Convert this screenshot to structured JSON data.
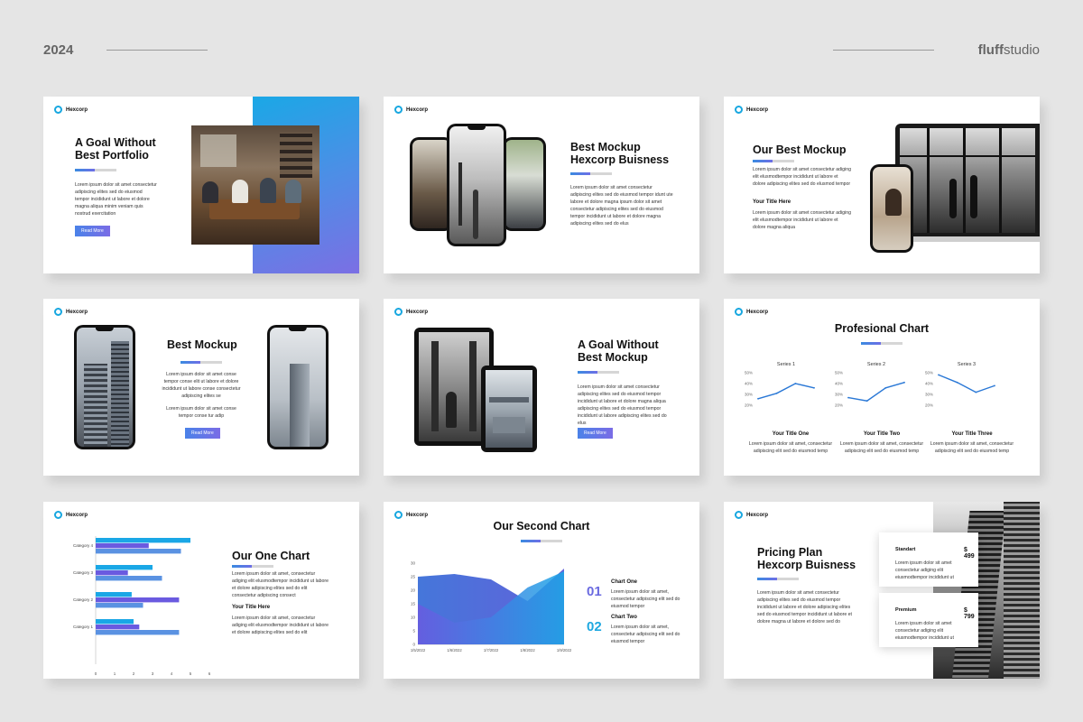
{
  "header": {
    "year": "2024",
    "brand_bold": "fluff",
    "brand_rest": "studio"
  },
  "logo_text": "Hexcorp",
  "lorem": "Lorem ipsum dolor sit amet consectetur adipiscing elites sed do eiusmod tempor incididunt ut labore et dolore",
  "slide1": {
    "title_l1": "A Goal Without",
    "title_l2": "Best Portfolio",
    "body": "Lorem ipsum dolor sit amet consectetur adipiscing elites sed do eiusmod tempor incididunt ut labore et dolore magna aliqua minim veniam quis nostrud exercitation",
    "button": "Read More"
  },
  "slide2": {
    "title_l1": "Best Mockup",
    "title_l2": "Hexcorp Buisness",
    "body": "Lorem ipsum dolor sit amet consectetur adipiscing elites sed do eiusmod tempor idunt ute labore et dolore magna ipsum dolor sit amet consectetur adipiscing elites sed do eiusmod tempor incididunt ut labore et dolore magna adipiscing elites sed do elus"
  },
  "slide3": {
    "title": "Our Best Mockup",
    "body1": "Lorem ipsum dolor sit amet consectetur adiging elit elusmodtempor incididunt ut labore et dolore adipiscing elites sed do elusmod tempor",
    "subtitle": "Your Title Here",
    "body2": "Lorem ipsum dolor sit amet consectetur adiging elit elusmodtempor incididunt ut labore et dolore magna aliqua"
  },
  "slide4": {
    "title": "Best Mockup",
    "body1": "Lorem ipsum dolor sit amet conse tempor conse elit ut labore et dolore incididunt ut labore conse consectetur adipiscing elites se",
    "body2": "Lorem ipsum dolor sit amet conse tempor conse tur adip",
    "button": "Read More"
  },
  "slide5": {
    "title_l1": "A Goal Without",
    "title_l2": "Best Mockup",
    "body": "Lorem ipsum dolor sit amet consectetur adipiscing elites sed do eiusmod tempor incididunt ut labore et dolore magna aliqua adipiscing elites sed do eiusmod tempor incididunt ut labore adipiscing elites sed do elus",
    "button": "Read More"
  },
  "slide6": {
    "title": "Profesional Chart",
    "items": [
      {
        "title": "Your Title One",
        "body": "Lorem ipsum dolor sit amet, consectetur adipiscing elit sed do eiusmod temp"
      },
      {
        "title": "Your Title Two",
        "body": "Lorem ipsum dolor sit amet, consectetur adipiscing elit sed do eiusmod temp"
      },
      {
        "title": "Your Title Three",
        "body": "Lorem ipsum dolor sit amet, consectetur adipiscing elit sed do eiusmod temp"
      }
    ]
  },
  "slide7": {
    "title": "Our One Chart",
    "body1": "Lorem ipsum dolor sit amet, consectetur adiging elit elusmodtempor incididunt ut labore et dolore adipiscing elites sed do elit consectetur adipiscing consect",
    "subtitle": "Your Title Here",
    "body2": "Lorem ipsum dolor sit amet, consectetur adiging elit elusmodtempor incididunt ut labore et dolore adipiscing elites sed do elit"
  },
  "slide8": {
    "title": "Our Second Chart",
    "items": [
      {
        "num": "01",
        "title": "Chart One",
        "body": "Lorem ipsum dolor sit amet, consectetur adipiscing elit sed do eiusmod tempor"
      },
      {
        "num": "02",
        "title": "Chart Two",
        "body": "Lorem ipsum dolor sit amet, consectetur adipiscing elit sed do eiusmod tempor"
      }
    ]
  },
  "slide9": {
    "title_l1": "Pricing Plan",
    "title_l2": "Hexcorp Buisness",
    "body": "Lorem ipsum dolor sit amet consectetur adipiscing elites sed do eiusmod tempor incididunt ut labore et dolore adipiscing elites sed do eiusmod tempor incididunt ut labore et dolore magna ut labore et dolore sed do",
    "plans": [
      {
        "name": "Standart",
        "price": "$ 499",
        "body": "Lorem ipsum dolor sit amet consectetur adiging elit eiusmodtempor incididunt ut"
      },
      {
        "name": "Premium",
        "price": "$ 799",
        "body": "Lorem ipsum dolor sit amet consectetur adiging elit eiusmodtempor incididunt ut"
      }
    ]
  },
  "chart_data": [
    {
      "type": "line",
      "series": [
        {
          "name": "Series 1",
          "values": [
            26,
            31,
            40,
            36
          ]
        },
        {
          "name": "Series 2",
          "values": [
            27,
            24,
            36,
            41
          ]
        },
        {
          "name": "Series 3",
          "values": [
            48,
            41,
            32,
            38
          ]
        }
      ],
      "y_ticks": [
        "50%",
        "40%",
        "30%",
        "20%"
      ],
      "ylim": [
        20,
        50
      ]
    },
    {
      "type": "bar",
      "categories": [
        "Category 1",
        "Category 2",
        "Category 3",
        "Category 4"
      ],
      "series": [
        {
          "values": [
            2.0,
            1.9,
            3.0,
            5.0
          ]
        },
        {
          "values": [
            2.3,
            4.4,
            1.7,
            2.8
          ]
        },
        {
          "values": [
            4.4,
            2.5,
            3.5,
            4.5
          ]
        }
      ],
      "x_ticks": [
        "0",
        "1",
        "2",
        "3",
        "4",
        "5",
        "6"
      ],
      "xlim": [
        0,
        6
      ]
    },
    {
      "type": "area",
      "x": [
        "1/5/2022",
        "1/6/2022",
        "1/7/2022",
        "1/8/2022",
        "1/9/2022"
      ],
      "series": [
        {
          "values": [
            25,
            26,
            24,
            16,
            28
          ]
        },
        {
          "values": [
            15,
            8,
            10,
            21,
            27
          ]
        }
      ],
      "y_ticks": [
        "30",
        "25",
        "20",
        "15",
        "10",
        "5",
        "0"
      ],
      "ylim": [
        0,
        30
      ]
    }
  ]
}
